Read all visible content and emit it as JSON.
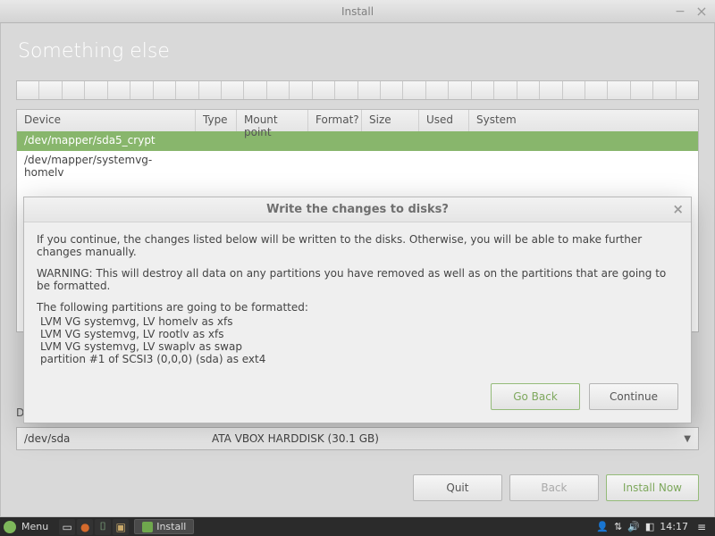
{
  "window": {
    "title": "Install"
  },
  "page": {
    "heading": "Something else"
  },
  "table": {
    "headers": {
      "device": "Device",
      "type": "Type",
      "mount": "Mount point",
      "format": "Format?",
      "size": "Size",
      "used": "Used",
      "system": "System"
    },
    "rows": [
      {
        "device": "/dev/mapper/sda5_crypt"
      },
      {
        "device": "/dev/mapper/systemvg-homelv"
      }
    ]
  },
  "bootloader_label_char": "D",
  "bootloader": {
    "device": "/dev/sda",
    "description": "ATA VBOX HARDDISK (30.1 GB)"
  },
  "footer": {
    "quit": "Quit",
    "back": "Back",
    "install": "Install Now"
  },
  "dialog": {
    "title": "Write the changes to disks?",
    "p1": "If you continue, the changes listed below will be written to the disks. Otherwise, you will be able to make further changes manually.",
    "p2": "WARNING: This will destroy all data on any partitions you have removed as well as on the partitions that are going to be formatted.",
    "p3": "The following partitions are going to be formatted:",
    "items": [
      "LVM VG systemvg, LV homelv as xfs",
      "LVM VG systemvg, LV rootlv as xfs",
      "LVM VG systemvg, LV swaplv as swap",
      "partition #1 of SCSI3 (0,0,0) (sda) as ext4"
    ],
    "go_back": "Go Back",
    "continue": "Continue"
  },
  "taskbar": {
    "menu": "Menu",
    "task": "Install",
    "clock": "14:17"
  }
}
